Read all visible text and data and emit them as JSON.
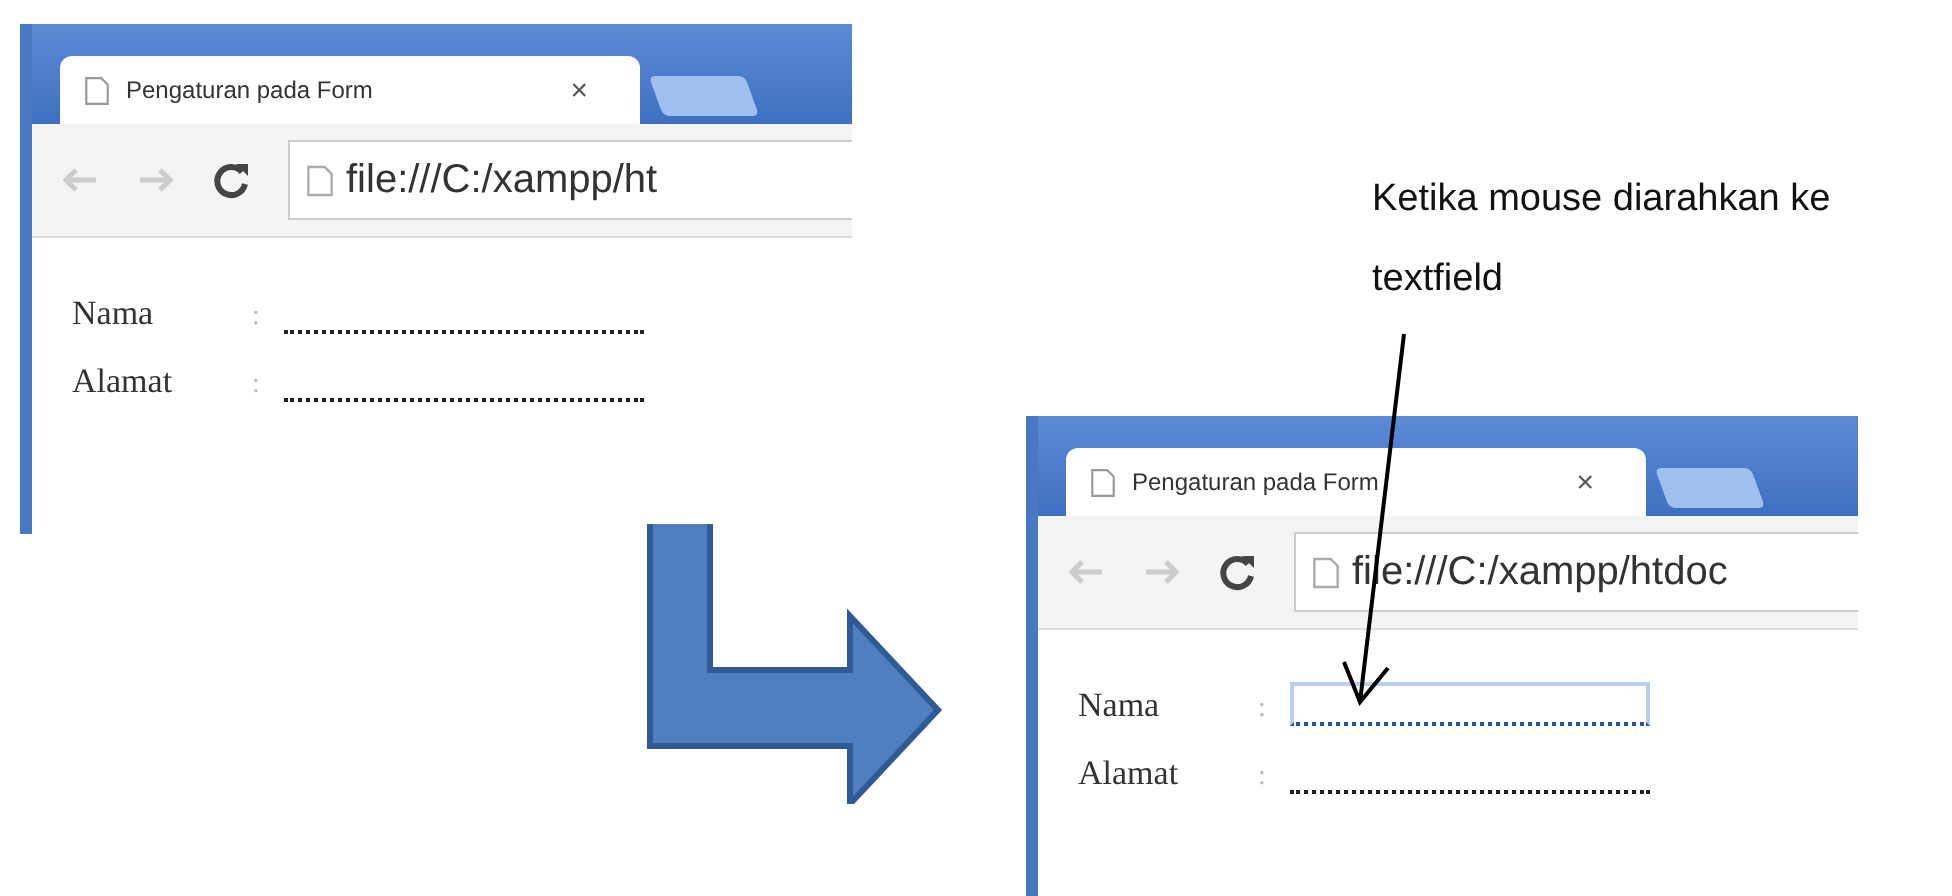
{
  "screenshots": [
    {
      "tab": {
        "title": "Pengaturan pada Form",
        "close": "×"
      },
      "address": "file:///C:/xampp/ht",
      "fields": [
        {
          "label": "Nama",
          "separator": ":",
          "focused": false
        },
        {
          "label": "Alamat",
          "separator": ":",
          "focused": false
        }
      ]
    },
    {
      "tab": {
        "title": "Pengaturan pada Form",
        "close": "×"
      },
      "address": "file:///C:/xampp/htdoc",
      "fields": [
        {
          "label": "Nama",
          "separator": ":",
          "focused": true
        },
        {
          "label": "Alamat",
          "separator": ":",
          "focused": false
        }
      ]
    }
  ],
  "annotation": "Ketika mouse diarahkan ke textfield"
}
